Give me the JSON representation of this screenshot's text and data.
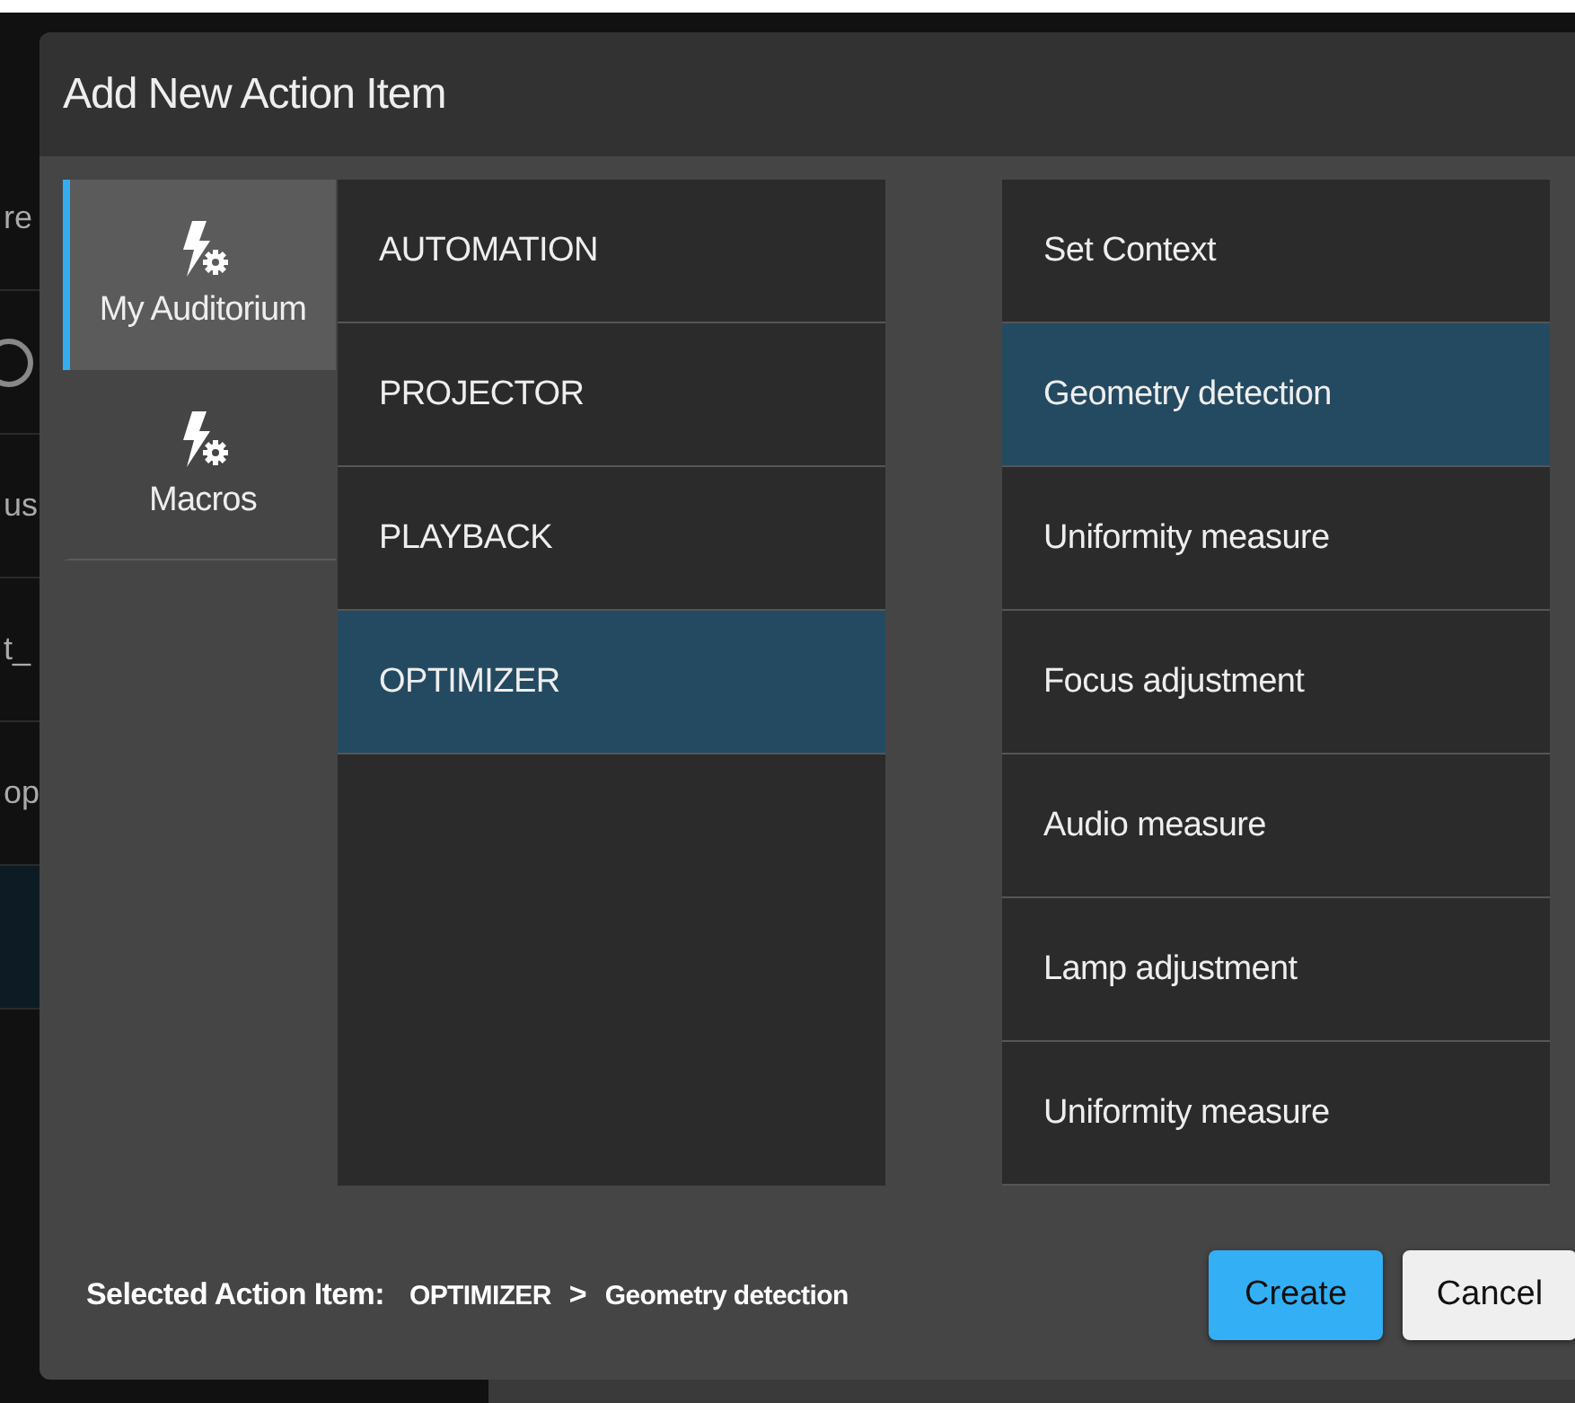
{
  "background": {
    "rows": [
      {
        "kind": "text",
        "text": "re"
      },
      {
        "kind": "icon"
      },
      {
        "kind": "text",
        "text": "us"
      },
      {
        "kind": "text",
        "text": "t_"
      },
      {
        "kind": "text",
        "text": "op"
      }
    ]
  },
  "dialog": {
    "title": "Add New Action Item",
    "sources": [
      {
        "label": "My Auditorium",
        "selected": true
      },
      {
        "label": "Macros",
        "selected": false
      }
    ],
    "categories": [
      {
        "label": "AUTOMATION",
        "selected": false
      },
      {
        "label": "PROJECTOR",
        "selected": false
      },
      {
        "label": "PLAYBACK",
        "selected": false
      },
      {
        "label": "OPTIMIZER",
        "selected": true
      }
    ],
    "actions": [
      {
        "label": "Set Context",
        "selected": false
      },
      {
        "label": "Geometry detection",
        "selected": true
      },
      {
        "label": "Uniformity measure",
        "selected": false
      },
      {
        "label": "Focus adjustment",
        "selected": false
      },
      {
        "label": "Audio measure",
        "selected": false
      },
      {
        "label": "Lamp adjustment",
        "selected": false
      },
      {
        "label": "Uniformity measure",
        "selected": false
      }
    ],
    "selection": {
      "label": "Selected Action Item:",
      "category": "OPTIMIZER",
      "separator": ">",
      "action": "Geometry detection"
    },
    "buttons": [
      {
        "label": "Create",
        "kind": "primary"
      },
      {
        "label": "Cancel",
        "kind": "secondary"
      }
    ]
  }
}
